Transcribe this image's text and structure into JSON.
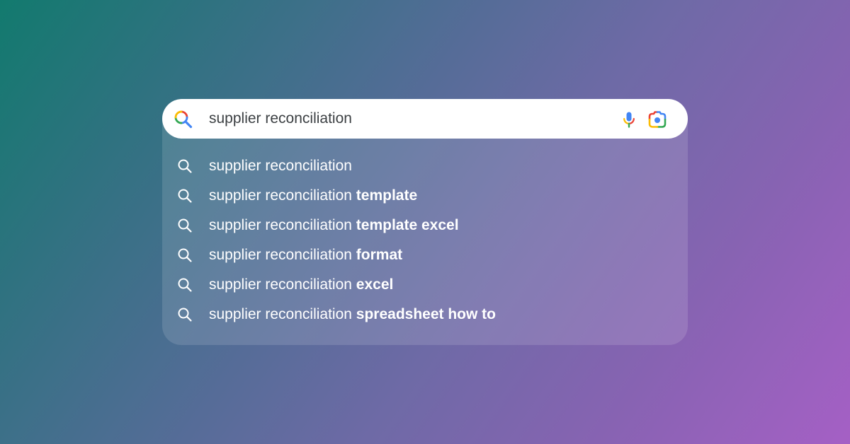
{
  "search": {
    "query": "supplier reconciliation",
    "search_icon": "google-color-search-icon",
    "voice_icon": "microphone-icon",
    "image_search_icon": "google-lens-camera-icon"
  },
  "suggestions": [
    {
      "prefix": "supplier reconciliation",
      "completion": ""
    },
    {
      "prefix": "supplier reconciliation ",
      "completion": "template"
    },
    {
      "prefix": "supplier reconciliation ",
      "completion": "template excel"
    },
    {
      "prefix": "supplier reconciliation ",
      "completion": "format"
    },
    {
      "prefix": "supplier reconciliation ",
      "completion": "excel"
    },
    {
      "prefix": "supplier reconciliation ",
      "completion": "spreadsheet how to"
    }
  ],
  "colors": {
    "google_blue": "#4285F4",
    "google_red": "#EA4335",
    "google_yellow": "#FBBC04",
    "google_green": "#34A853",
    "suggestion_text": "#FFFFFF",
    "query_text": "#3C4043"
  }
}
